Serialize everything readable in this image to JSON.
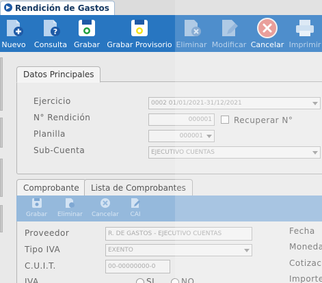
{
  "window": {
    "title": "Rendición de Gastos"
  },
  "toolbar": {
    "buttons": [
      {
        "label": "Nuevo",
        "icon": "new-document-icon",
        "enabled": true
      },
      {
        "label": "Consulta",
        "icon": "query-document-icon",
        "enabled": true
      },
      {
        "label": "Grabar",
        "icon": "save-icon",
        "enabled": true
      },
      {
        "label": "Grabar Provisorio",
        "icon": "save-draft-icon",
        "enabled": true
      },
      {
        "label": "Eliminar",
        "icon": "delete-document-icon",
        "enabled": false
      },
      {
        "label": "Modificar",
        "icon": "edit-document-icon",
        "enabled": false
      },
      {
        "label": "Cancelar",
        "icon": "cancel-icon",
        "enabled": true
      },
      {
        "label": "Imprimir",
        "icon": "printer-icon",
        "enabled": false
      }
    ]
  },
  "datos": {
    "tab_label": "Datos Principales",
    "ejercicio": {
      "label": "Ejercicio",
      "value": "0002 01/01/2021-31/12/2021"
    },
    "rendicion": {
      "label": "N° Rendición",
      "value": "000001"
    },
    "recuperar": {
      "label": "Recuperar N°",
      "checked": false
    },
    "planilla": {
      "label": "Planilla",
      "value": "000001"
    },
    "subcuenta": {
      "label": "Sub-Cuenta",
      "value": "EJECUTIVO CUENTAS"
    }
  },
  "comprobante": {
    "tabs": [
      "Comprobante",
      "Lista de Comprobantes"
    ],
    "subtoolbar": [
      "Grabar",
      "Eliminar",
      "Cancelar",
      "CAI"
    ],
    "proveedor": {
      "label": "Proveedor",
      "value": "R. DE GASTOS - EJECUTIVO CUENTAS"
    },
    "tipo_iva": {
      "label": "Tipo IVA",
      "value": "EXENTO"
    },
    "cuit": {
      "label": "C.U.I.T.",
      "value": "00-00000000-0"
    },
    "iva": {
      "label": "IVA",
      "options": [
        "SI",
        "NO"
      ],
      "selected": "NO"
    },
    "right_labels": [
      "Fecha",
      "Moneda",
      "Cotización",
      "Importe"
    ]
  },
  "colors": {
    "toolbar": "#2876c1",
    "subtoolbar": "#95b9dc",
    "accent_red": "#d9534f",
    "icon_yellow": "#f3e21b"
  }
}
